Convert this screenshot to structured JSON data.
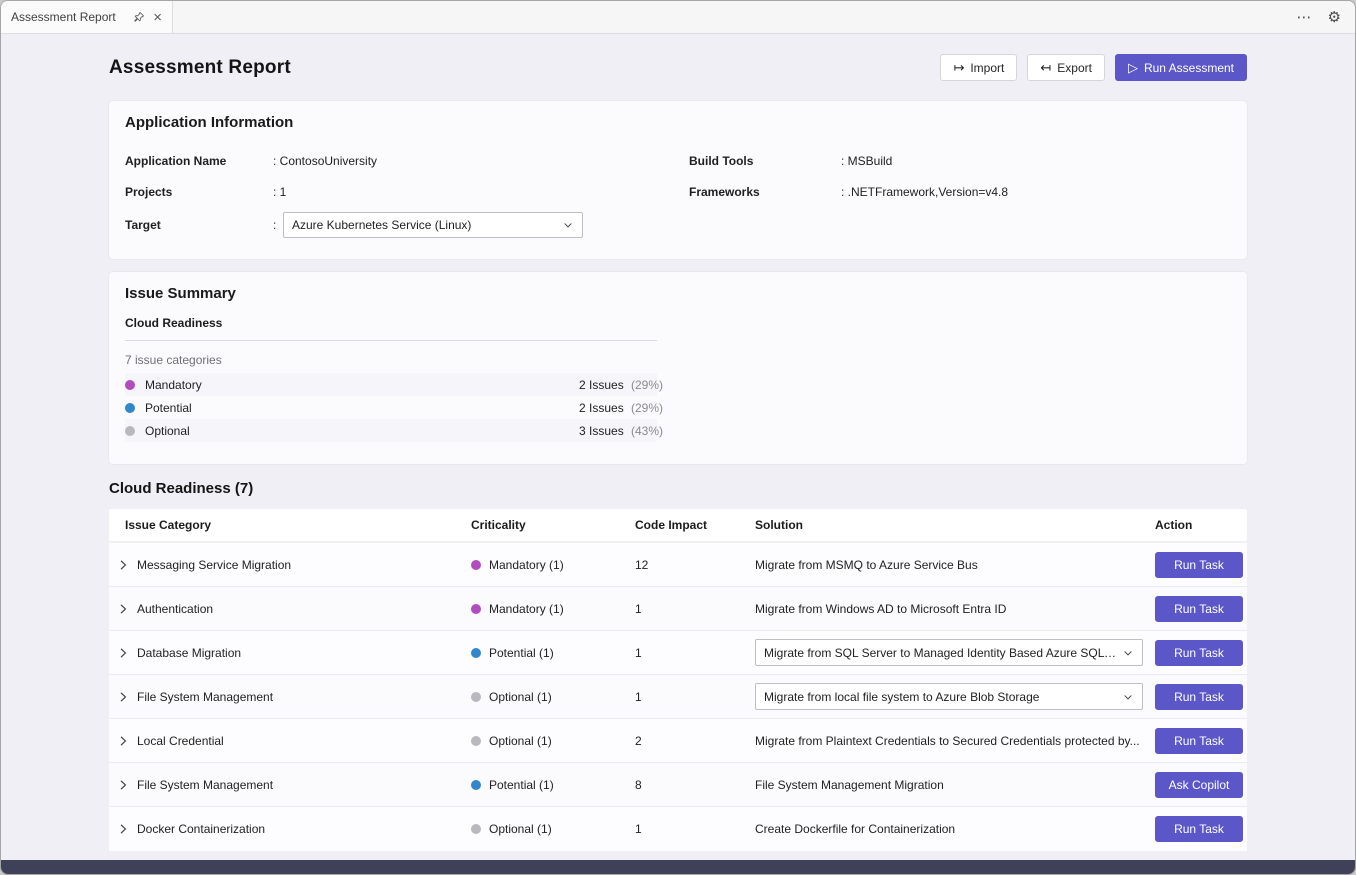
{
  "glyphs": {
    "more": "⋯",
    "settings": "⚙",
    "close": "×",
    "play": "▷",
    "import_arrow": "↦",
    "export_arrow": "↤"
  },
  "colors": {
    "accent": "#5b57c8",
    "mandatory": "#b34bc0",
    "potential": "#3186cc",
    "optional": "#b9b8be"
  },
  "tab": {
    "title": "Assessment Report"
  },
  "page": {
    "title": "Assessment Report",
    "buttons": {
      "import": "Import",
      "export": "Export",
      "run_assessment": "Run Assessment"
    }
  },
  "app_info": {
    "title": "Application Information",
    "rows_left": [
      {
        "label": "Application Name",
        "value": ": ContosoUniversity"
      },
      {
        "label": "Projects",
        "value": ": 1"
      }
    ],
    "target": {
      "label": "Target",
      "colon": ":",
      "value": "Azure Kubernetes Service (Linux)"
    },
    "rows_right": [
      {
        "label": "Build Tools",
        "value": ": MSBuild"
      },
      {
        "label": "Frameworks",
        "value": ": .NETFramework,Version=v4.8"
      }
    ]
  },
  "issue_summary": {
    "title": "Issue Summary",
    "group_title": "Cloud Readiness",
    "categories_label": "7 issue categories",
    "legend": [
      {
        "name": "Mandatory",
        "count": "2 Issues",
        "pct": "(29%)",
        "color": "#b34bc0"
      },
      {
        "name": "Potential",
        "count": "2 Issues",
        "pct": "(29%)",
        "color": "#3186cc"
      },
      {
        "name": "Optional",
        "count": "3 Issues",
        "pct": "(43%)",
        "color": "#b9b8be"
      }
    ]
  },
  "issues": {
    "title": "Cloud Readiness (7)",
    "headers": [
      "Issue Category",
      "Criticality",
      "Code Impact",
      "Solution",
      "Action"
    ],
    "rows": [
      {
        "category": "Messaging Service Migration",
        "criticality": "Mandatory (1)",
        "color": "#b34bc0",
        "impact": "12",
        "solution": "Migrate from MSMQ to Azure Service Bus",
        "solution_type": "text",
        "action": "Run Task"
      },
      {
        "category": "Authentication",
        "criticality": "Mandatory (1)",
        "color": "#b34bc0",
        "impact": "1",
        "solution": "Migrate from Windows AD to Microsoft Entra ID",
        "solution_type": "text",
        "action": "Run Task"
      },
      {
        "category": "Database Migration",
        "criticality": "Potential (1)",
        "color": "#3186cc",
        "impact": "1",
        "solution": "Migrate from SQL Server to Managed Identity Based Azure SQL Dat...",
        "solution_type": "select",
        "action": "Run Task"
      },
      {
        "category": "File System Management",
        "criticality": "Optional (1)",
        "color": "#b9b8be",
        "impact": "1",
        "solution": "Migrate from local file system to Azure Blob Storage",
        "solution_type": "select",
        "action": "Run Task"
      },
      {
        "category": "Local Credential",
        "criticality": "Optional (1)",
        "color": "#b9b8be",
        "impact": "2",
        "solution": "Migrate from Plaintext Credentials to Secured Credentials protected by...",
        "solution_type": "text",
        "action": "Run Task"
      },
      {
        "category": "File System Management",
        "criticality": "Potential (1)",
        "color": "#3186cc",
        "impact": "8",
        "solution": "File System Management Migration",
        "solution_type": "text",
        "action": "Ask Copilot"
      },
      {
        "category": "Docker Containerization",
        "criticality": "Optional (1)",
        "color": "#b9b8be",
        "impact": "1",
        "solution": "Create Dockerfile for Containerization",
        "solution_type": "text",
        "action": "Run Task"
      }
    ]
  }
}
